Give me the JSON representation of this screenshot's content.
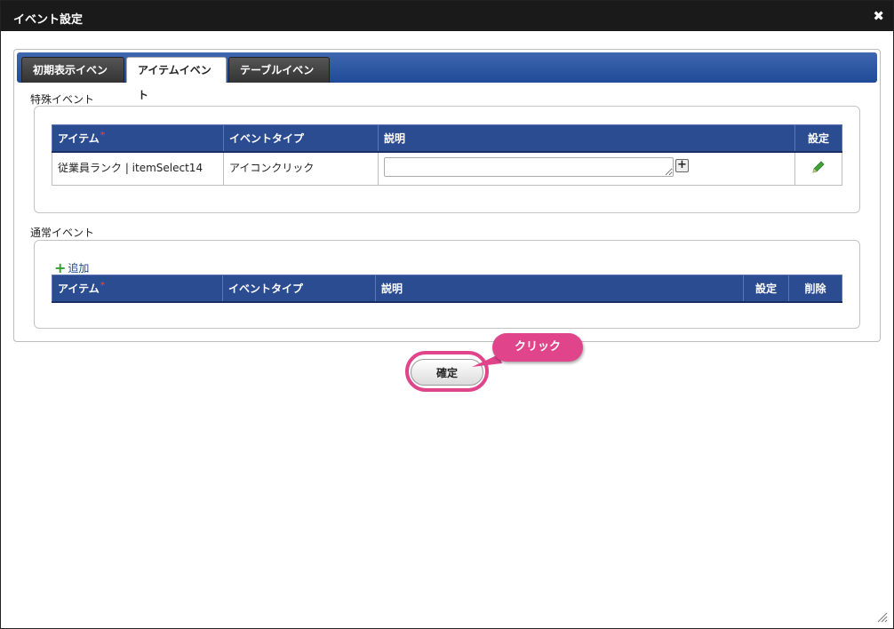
{
  "dialog": {
    "title": "イベント設定",
    "close": "✖"
  },
  "tabs": [
    {
      "label": "初期表示イベント",
      "active": false
    },
    {
      "label": "アイテムイベント",
      "active": true
    },
    {
      "label": "テーブルイベント",
      "active": false
    }
  ],
  "special_events": {
    "label": "特殊イベント",
    "columns": {
      "item": "アイテム",
      "event_type": "イベントタイプ",
      "description": "説明",
      "settings": "設定"
    },
    "rows": [
      {
        "item": "従業員ランク | itemSelect14",
        "event_type": "アイコンクリック",
        "description": ""
      }
    ]
  },
  "normal_events": {
    "label": "通常イベント",
    "add_label": "追加",
    "columns": {
      "item": "アイテム",
      "event_type": "イベントタイプ",
      "description": "説明",
      "settings": "設定",
      "delete": "削除"
    }
  },
  "confirm_label": "確定",
  "callout_label": "クリック",
  "colors": {
    "tab_bar": "#2c4c92",
    "header": "#2c4c92",
    "highlight": "#e0458b",
    "add_icon": "#2ea22e"
  }
}
